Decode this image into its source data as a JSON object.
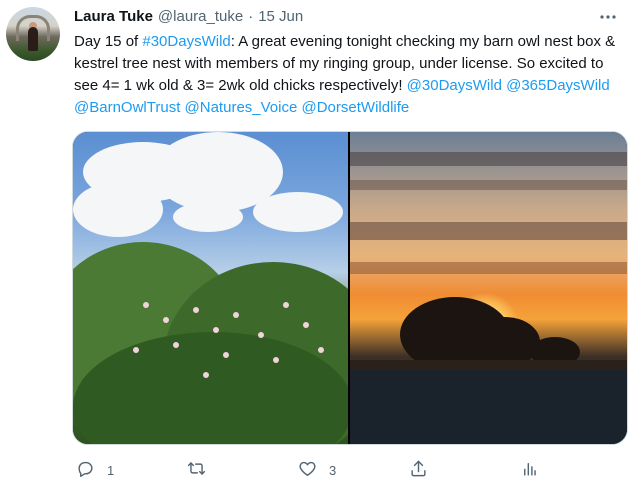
{
  "author": {
    "name": "Laura Tuke",
    "handle": "@laura_tuke",
    "separator": "·",
    "date": "15 Jun"
  },
  "tweet": {
    "text_1": "Day 15 of ",
    "hashtag": "#30DaysWild",
    "text_2": ": A great evening tonight checking my barn owl nest box & kestrel tree nest with members of my ringing group, under license. So excited to see 4= 1 wk old & 3= 2wk old chicks respectively! ",
    "mention_1": "@30DaysWild",
    "mention_2": "@365DaysWild",
    "mention_3": "@BarnOwlTrust",
    "mention_4": "@Natures_Voice",
    "mention_5": "@DorsetWildlife"
  },
  "actions": {
    "reply_count": "1",
    "retweet_count": "",
    "like_count": "3"
  },
  "icons": {
    "more": "more-horizontal-icon",
    "reply": "reply-icon",
    "retweet": "retweet-icon",
    "like": "heart-icon",
    "share": "share-icon",
    "analytics": "analytics-icon"
  },
  "colors": {
    "link": "#1d9bf0",
    "secondary_text": "#536471",
    "primary_text": "#0f1419",
    "border": "#cfd9de"
  }
}
